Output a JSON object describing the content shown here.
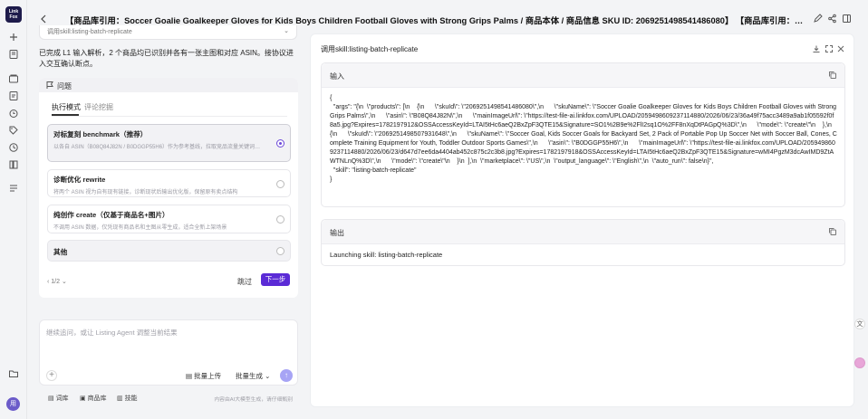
{
  "rail": {
    "logo_text": "Link\nFox"
  },
  "header": {
    "title": "【商品库引用：Soccer Goalie Goalkeeper Gloves for Kids Boys Children Football Gloves with Strong Grips Palms / 商品本体 / 商品信息 SKU ID: 2069251498541486080】 【商品库引用：Soccer Goal, Kids Soccer Go..."
  },
  "chat": {
    "top_card_text": "调用skill:listing-batch-replicate",
    "message": "已完成 L1 输入解析，2 个商品均已识别并各有一张主图和对应 ASIN。接协议进入交互确认断点。",
    "question": {
      "label": "问题",
      "tabs": [
        "执行模式",
        "评论挖掘"
      ],
      "options": [
        {
          "title": "对标复刻 benchmark（推荐）",
          "desc": "以各自 ASIN（B08Q84J82N / B0DGGP55H6）作为参考基线，拉取竞品流量关键词期并，生成差异化新 Listing",
          "selected": true
        },
        {
          "title": "诊断优化 rewrite",
          "desc": "将两个 ASIN 视为自有现有链接，诊断现状后输出优化版，保留原有卖点结构",
          "selected": false
        },
        {
          "title": "纯创作 create（仅基于商品名+图片）",
          "desc": "不调用 ASIN 数据，仅凭现有商品名和主图从零生成，适合全新上架场景",
          "selected": false
        },
        {
          "title": "其他",
          "desc": "",
          "selected": false
        }
      ],
      "pager": "1/2",
      "skip_label": "跳过",
      "next_label": "下一步"
    },
    "input": {
      "placeholder": "继续追问，或让 Listing Agent 调整当前结果",
      "add_label": "+",
      "upload_label": "批量上传",
      "batch_label": "批量生成",
      "send_label": "↑"
    },
    "footer": {
      "items": [
        "词库",
        "商品库",
        "技能"
      ],
      "disclaimer": "内容由AI大模型生成，请仔细甄别"
    }
  },
  "panel": {
    "title": "调用skill:listing-batch-replicate",
    "input_label": "输入",
    "input_code": "{\n  \"args\": \"{\\n  \\\"products\\\": [\\n    {\\n      \\\"skuId\\\": \\\"2069251498541486080\\\",\\n      \\\"skuName\\\": \\\"Soccer Goalie Goalkeeper Gloves for Kids Boys Children Football Gloves with Strong Grips Palms\\\",\\n      \\\"asin\\\": \\\"B08Q84J82N\\\",\\n      \\\"mainImageUrl\\\": \\\"https://test-file-ai.linkfox.com/UPLOAD/2059498609237114880/2026/06/23/36a49f75acc3489a9ab1f05592f0f8a5.jpg?Expires=1782197912&OSSAccessKeyId=LTAI5tHc6aeQ2BxZpF3QTE15&Signature=SO1%2B9e%2FlI2sq1O%2FF8nXqDtPAGpQ%3D\\\",\\n      \\\"mode\\\": \\\"create\\\"\\n    },\\n    {\\n      \\\"skuId\\\": \\\"2069251498507931648\\\",\\n      \\\"skuName\\\": \\\"Soccer Goal, Kids Soccer Goals for Backyard Set, 2 Pack of Portable Pop Up Soccer Net with Soccer Ball, Cones, Complete Training Equipment for Youth, Toddler Outdoor Sports Games\\\",\\n      \\\"asin\\\": \\\"B0DGGP55H6\\\",\\n      \\\"mainImageUrl\\\": \\\"https://test-file-ai.linkfox.com/UPLOAD/2059498609237114880/2026/06/23/d647d7ee6da4404ab452c875c2c3b8.jpg?Expires=1782197918&OSSAccessKeyId=LTAI5tHc6aeQ2BxZpF3QTE15&Signature=wMI4PgzM3dcAwIMD9ZtAWTNLnQ%3D\\\",\\n      \\\"mode\\\": \\\"create\\\"\\n    }\\n  ],\\n  \\\"marketplace\\\": \\\"US\\\",\\n  \\\"output_language\\\": \\\"English\\\",\\n  \\\"auto_run\\\": false\\n}\",\n  \"skill\": \"listing-batch-replicate\"\n}",
    "output_label": "输出",
    "output_text": "Launching skill: listing-batch-replicate"
  },
  "colors": {
    "accent": "#5b2bd6",
    "send": "#a7a4f5",
    "avatar": "#6b5bc9"
  },
  "avatar_text": "用"
}
